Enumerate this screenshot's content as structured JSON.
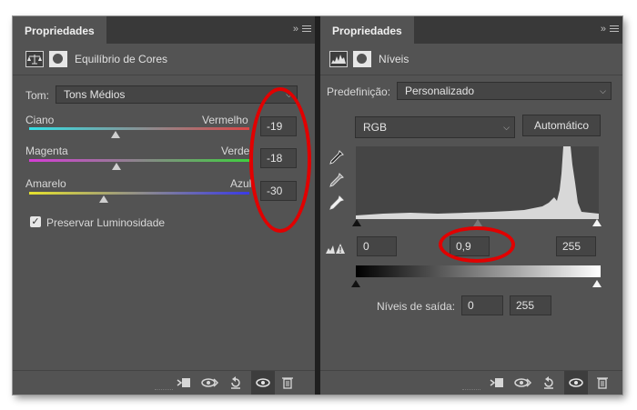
{
  "left_panel": {
    "tab_title": "Propriedades",
    "collapse_glyph": "»",
    "subtitle": "Equilíbrio de Cores",
    "tone_label": "Tom:",
    "tone_value": "Tons Médios",
    "sliders": [
      {
        "left_label": "Ciano",
        "right_label": "Vermelho",
        "value": "-19",
        "position": -19
      },
      {
        "left_label": "Magenta",
        "right_label": "Verde",
        "value": "-18",
        "position": -18
      },
      {
        "left_label": "Amarelo",
        "right_label": "Azul",
        "value": "-30",
        "position": -30
      }
    ],
    "preserve_label": "Preservar Luminosidade",
    "preserve_checked": true,
    "checkmark": "✓"
  },
  "right_panel": {
    "tab_title": "Propriedades",
    "collapse_glyph": "»",
    "subtitle": "Níveis",
    "preset_label": "Predefinição:",
    "preset_value": "Personalizado",
    "channel_value": "RGB",
    "auto_button": "Automático",
    "input_black": "0",
    "input_gamma": "0,9",
    "input_white": "255",
    "output_label": "Níveis de saída:",
    "output_black": "0",
    "output_white": "255"
  },
  "footer_icons": [
    "clip-to-layer-icon",
    "view-previous-state-icon",
    "reset-icon",
    "visibility-eye-icon",
    "trash-icon"
  ],
  "colors": {
    "panel_bg": "#535353",
    "tabbar_bg": "#393939",
    "field_bg": "#454545",
    "annotation": "#e10000"
  }
}
